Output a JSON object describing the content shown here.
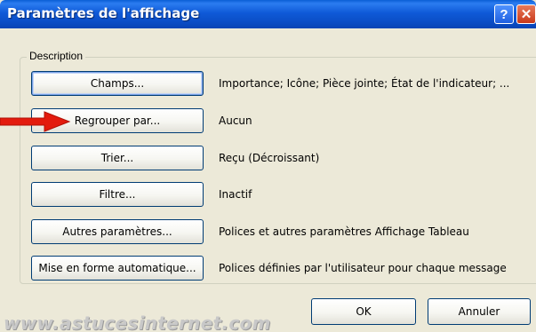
{
  "window": {
    "title": "Paramètres de l'affichage",
    "help_glyph": "?",
    "close_glyph": "✕"
  },
  "group": {
    "label": "Description"
  },
  "rows": [
    {
      "button": "Champs...",
      "description": "Importance; Icône; Pièce jointe; État de l'indicateur; ..."
    },
    {
      "button": "Regrouper par...",
      "description": "Aucun"
    },
    {
      "button": "Trier...",
      "description": "Reçu (Décroissant)"
    },
    {
      "button": "Filtre...",
      "description": "Inactif"
    },
    {
      "button": "Autres paramètres...",
      "description": "Polices et autres paramètres Affichage Tableau"
    },
    {
      "button": "Mise en forme automatique...",
      "description": "Polices définies par l'utilisateur pour chaque message"
    }
  ],
  "footer": {
    "ok_label": "OK",
    "cancel_label": "Annuler"
  },
  "watermark": "www.astucesinternet.com",
  "colors": {
    "titlebar": "#0a4cc4",
    "dialog_bg": "#ece9d8",
    "button_border": "#003c74",
    "arrow": "#e31b0e"
  }
}
